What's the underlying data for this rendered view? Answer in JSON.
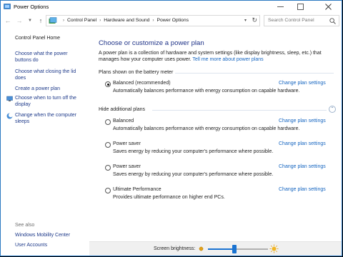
{
  "window": {
    "title": "Power Options"
  },
  "address": {
    "crumbs": [
      "Control Panel",
      "Hardware and Sound",
      "Power Options"
    ],
    "search_placeholder": "Search Control Panel"
  },
  "sidebar": {
    "home": "Control Panel Home",
    "links": [
      [
        "Choose what the power",
        "buttons do"
      ],
      [
        "Choose what closing the lid",
        "does"
      ],
      [
        "Create a power plan"
      ],
      [
        "Choose when to turn off the",
        "display"
      ],
      [
        "Change when the computer",
        "sleeps"
      ]
    ],
    "see_also": "See also",
    "see_also_links": [
      "Windows Mobility Center",
      "User Accounts"
    ]
  },
  "main": {
    "heading": "Choose or customize a power plan",
    "intro": "A power plan is a collection of hardware and system settings (like display brightness, sleep, etc.) that manages how your computer uses power.",
    "intro_link": "Tell me more about power plans",
    "battery_meter_label": "Plans shown on the battery meter",
    "hide_label": "Hide additional plans",
    "change_label": "Change plan settings",
    "plans": [
      {
        "name": "Balanced (recommended)",
        "desc": "Automatically balances performance with energy consumption on capable hardware.",
        "selected": true
      },
      {
        "name": "Balanced",
        "desc": "Automatically balances performance with energy consumption on capable hardware.",
        "selected": false
      },
      {
        "name": "Power saver",
        "desc": "Saves energy by reducing your computer's performance where possible.",
        "selected": false
      },
      {
        "name": "Power saver",
        "desc": "Saves energy by reducing your computer's performance where possible.",
        "selected": false
      },
      {
        "name": "Ultimate Performance",
        "desc": "Provides ultimate performance on higher end PCs.",
        "selected": false
      }
    ]
  },
  "brightness": {
    "label": "Screen brightness:",
    "level": 0.44
  },
  "colors": {
    "accent": "#1a73d1",
    "link": "#1565c0",
    "heading": "#1e3287"
  }
}
